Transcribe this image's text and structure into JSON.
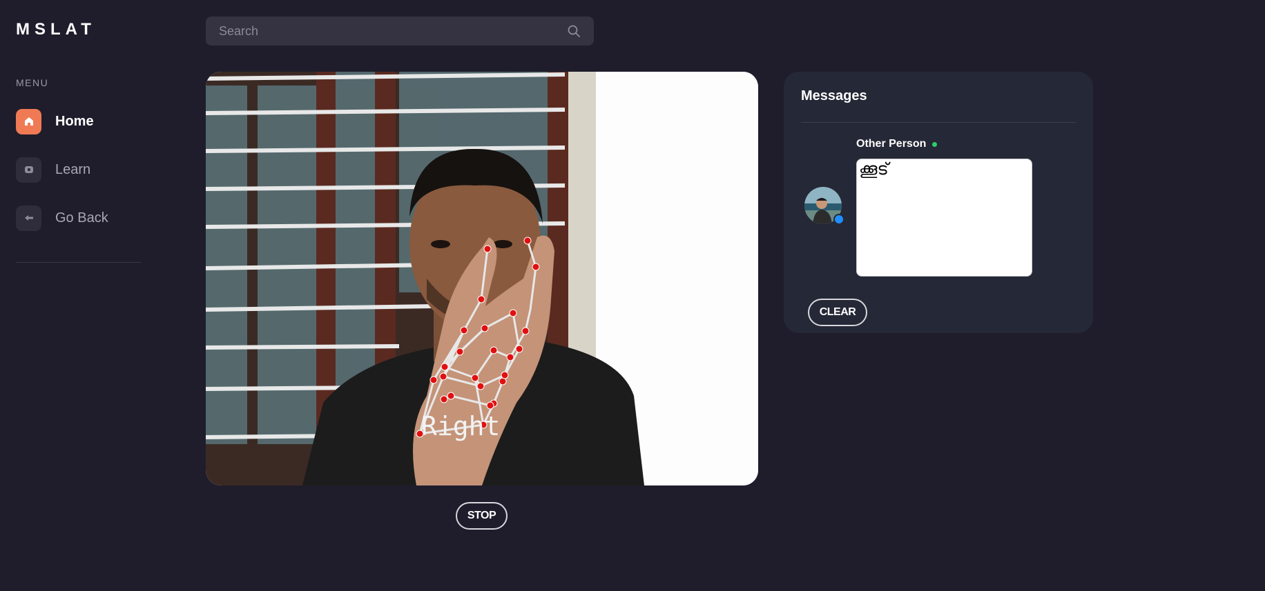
{
  "app": {
    "logo": "MSLAT"
  },
  "sidebar": {
    "menu_title": "MENU",
    "items": [
      {
        "label": "Home",
        "icon": "home-icon",
        "active": true
      },
      {
        "label": "Learn",
        "icon": "learn-icon",
        "active": false
      },
      {
        "label": "Go Back",
        "icon": "back-icon",
        "active": false
      }
    ]
  },
  "search": {
    "placeholder": "Search",
    "value": ""
  },
  "video": {
    "overlay_label": "Right",
    "stop_label": "STOP"
  },
  "messages": {
    "title": "Messages",
    "sender_name": "Other Person",
    "sender_status": "online",
    "message_text": "ക്കൂട്",
    "clear_label": "CLEAR"
  },
  "colors": {
    "background": "#1f1d2b",
    "accent": "#f07a54",
    "panel": "#252836",
    "online": "#2ecc71",
    "landmark": "#e01010"
  }
}
